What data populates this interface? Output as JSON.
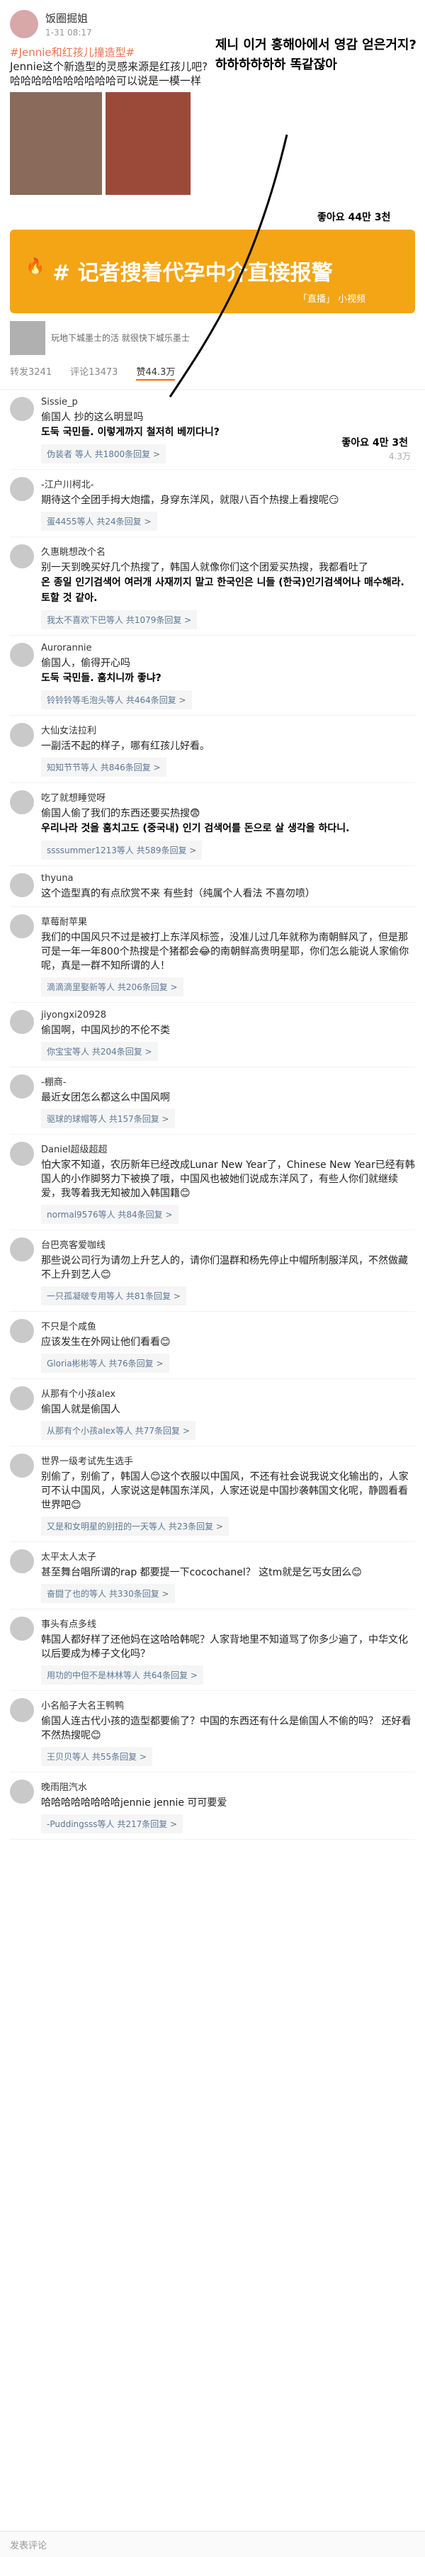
{
  "post": {
    "author": "饭圈掘姐",
    "time": "1-31 08:17",
    "text_tag": "#Jennie和红孩儿撞造型#",
    "text_body": "Jennie这个新造型的灵感来源是红孩儿吧? 哈哈哈哈哈哈哈哈哈哈可以说是一模一样",
    "ko_overlay": "제니 이거 홍해아에서 영감 얻은거지? 하하하하하하 똑같잖아",
    "banner_title": "# 记者搜着代孕中介直接报警",
    "banner_sub": "「直播」 小视频",
    "ko_likes_top": "좋아요 44만 3천",
    "repost_text": "玩地下城墨士的活 就很快下城乐墨士"
  },
  "stats": {
    "share": "转发3241",
    "comments": "评论13473",
    "likes": "赞44.3万"
  },
  "comments": [
    {
      "name": "Sissie_p",
      "text": "偷国人 抄的这么明显吗",
      "ko": "도둑 국민들. 이렇게까지 철저히 베끼다니?",
      "reply": "伪装者 等人 共1800条回复 >",
      "like": "4.3万",
      "ko2": "좋아요 4만 3천"
    },
    {
      "name": "-江户川柯北-",
      "text": "期待这个全团手拇大炮擂，身穿东洋风，就限八百个热搜上看搜呢😏",
      "reply": "蛋4455等人 共24条回复 >",
      "like": ""
    },
    {
      "name": "久惠眺想改个名",
      "text": "别一天到晚买好几个热搜了，韩国人就像你们这个团爱买热搜，我都看吐了",
      "ko": "온 종일 인기검색어 여러개 사재끼지 말고 한국인은 니들 (한국)인기검색어나 매수해라. 토할 것 같아.",
      "reply": "我太不喜欢下巴等人 共1079条回复 >",
      "like": ""
    },
    {
      "name": "Aurorannie",
      "text": "偷国人，偷得开心吗",
      "ko": "도둑 국민들. 훔치니까 좋냐?",
      "reply": "铃铃铃等毛泡头等人 共464条回复 >",
      "like": ""
    },
    {
      "name": "大仙女法拉利",
      "text": "一副活不起的样子，哪有红孩儿好看。",
      "reply": "知知节节等人 共846条回复 >",
      "like": ""
    },
    {
      "name": "吃了就想睡觉呀",
      "text": "偷国人偷了我们的东西还要买热搜😨",
      "ko": "우리나라 것을 훔치고도 (중국내) 인기 검색어를 돈으로 살 생각을 하다니.",
      "reply": "ssssummer1213等人 共589条回复 >",
      "like": ""
    },
    {
      "name": "thyuna",
      "text": "这个造型真的有点欣赏不来 有些封（纯属个人看法 不喜勿喷）",
      "reply": "",
      "like": ""
    },
    {
      "name": "草莓耐苹果",
      "text": "我们的中国风只不过是被打上东洋风标签，没准儿过几年就称为南朝鲜风了，但是那可是一年一年800个热搜是个猪都会😂的南朝鲜高贵明星耶，你们怎么能说人家偷你呢，真是一群不知所谓的人！",
      "reply": "滴滴滴里娶新等人 共206条回复 >",
      "like": ""
    },
    {
      "name": "jiyongxi20928",
      "text": "偷国啊，中国风抄的不伦不类",
      "reply": "你宝宝等人 共204条回复 >",
      "like": ""
    },
    {
      "name": "-棚商-",
      "text": "最近女团怎么都这么中国风啊",
      "reply": "驱球的球帽等人 共157条回复 >",
      "like": ""
    },
    {
      "name": "Daniel超级超超",
      "text": "怕大家不知道，农历新年已经改成Lunar New Year了，Chinese New Year已经有韩国人的小作脚努力下被换了哦，中国风也被她们说成东洋风了，有些人你们就继续爱，我等着我无知被加入韩国籍😊",
      "reply": "normal9576等人 共84条回复 >",
      "like": ""
    },
    {
      "name": "台巴亮客爱咖线",
      "text": "那些说公司行为请勿上升艺人的，请你们温群和杨先停止中帽所制服洋风，不然做藏不上升到艺人😊",
      "reply": "一只孤凝啵专用等人 共81条回复 >",
      "like": ""
    },
    {
      "name": "不只是个咸鱼",
      "text": "应该发生在外网让他们看看😊",
      "reply": "Gloria彬彬等人 共76条回复 >",
      "like": ""
    },
    {
      "name": "从那有个小孩alex",
      "text": "偷国人就是偷国人",
      "reply": "从那有个小孩alex等人 共77条回复 >",
      "like": ""
    },
    {
      "name": "世界一级考试先生选手",
      "text": "别偷了，别偷了，韩国人😊这个衣服以中国风，不还有社会说我说文化输出的，人家可不认中国风，人家说这是韩国东洋风，人家还说是中国抄袭韩国文化呢，静圆看看世界吧😊",
      "reply": "又是和女明星的别扭的一天等人 共23条回复 >",
      "like": ""
    },
    {
      "name": "太平太人太子",
      "text": "甚至舞台唱所谓的rap 都要提一下cocochanel？ 这tm就是乞丐女团么😊",
      "reply": "奋闘了也的等人 共330条回复 >",
      "like": ""
    },
    {
      "name": "事头有点多线",
      "text": "韩国人都好样了还他妈在这哈哈韩呢？人家背地里不知道骂了你多少遍了，中华文化以后要成为棒子文化吗？",
      "reply": "用功的中但不是林林等人 共64条回复 >",
      "like": ""
    },
    {
      "name": "小名船子大名王鸭鸭",
      "text": "偷国人连古代小孩的造型都要偷了？中国的东西还有什么是偷国人不偷的吗？ 还好看不然热搜呢😊",
      "reply": "王贝贝等人 共55条回复 >",
      "like": ""
    },
    {
      "name": "晚雨阻汽水",
      "text": "哈哈哈哈哈哈哈哈jennie jennie 可可要爱",
      "reply": "-Puddingsss等人 共217条回复 >",
      "like": ""
    }
  ],
  "bottom": {
    "placeholder": "发表评论"
  }
}
